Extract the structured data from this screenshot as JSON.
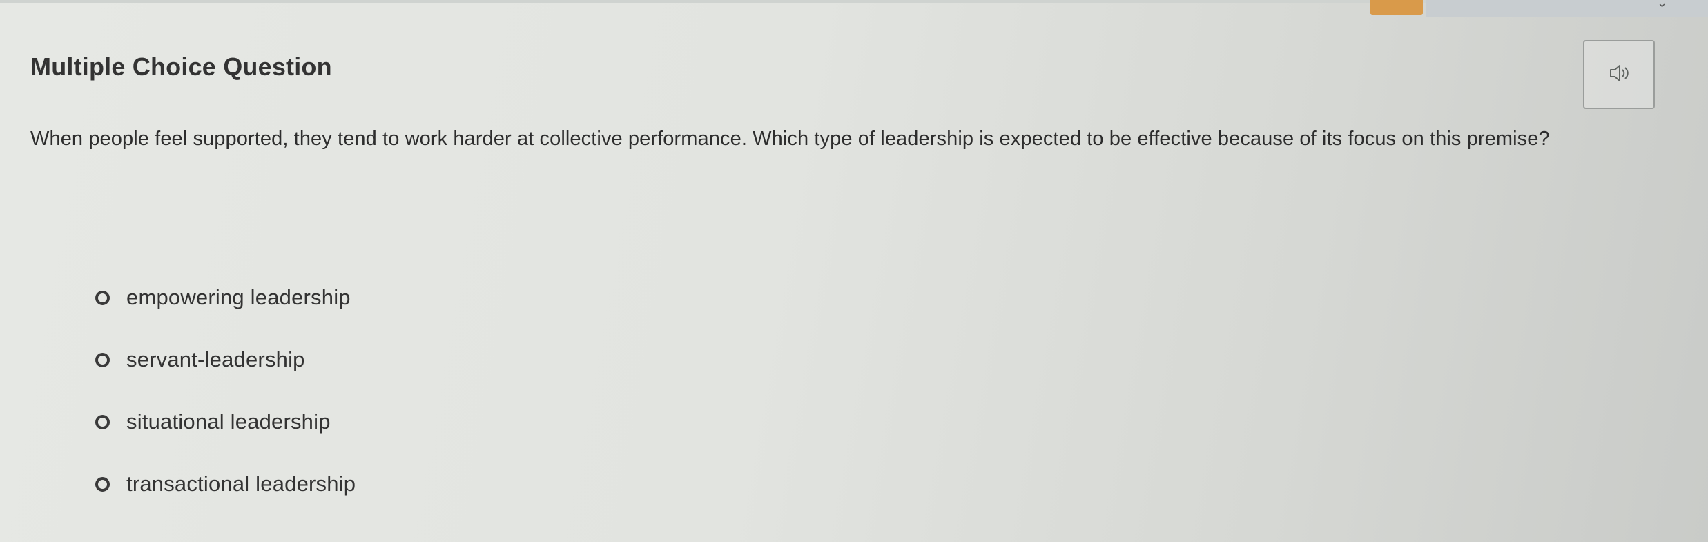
{
  "question": {
    "heading": "Multiple Choice Question",
    "prompt": "When people feel supported, they tend to work harder at collective performance. Which type of leadership is expected to be effective because of its focus on this premise?",
    "audio_icon": "speaker-icon"
  },
  "options": [
    {
      "label": "empowering leadership",
      "selected": false
    },
    {
      "label": "servant-leadership",
      "selected": false
    },
    {
      "label": "situational leadership",
      "selected": false
    },
    {
      "label": "transactional leadership",
      "selected": false
    }
  ],
  "colors": {
    "orange_tab": "#d99a4a",
    "text": "#2b2b2b",
    "radio_border": "#3a3a3a"
  }
}
